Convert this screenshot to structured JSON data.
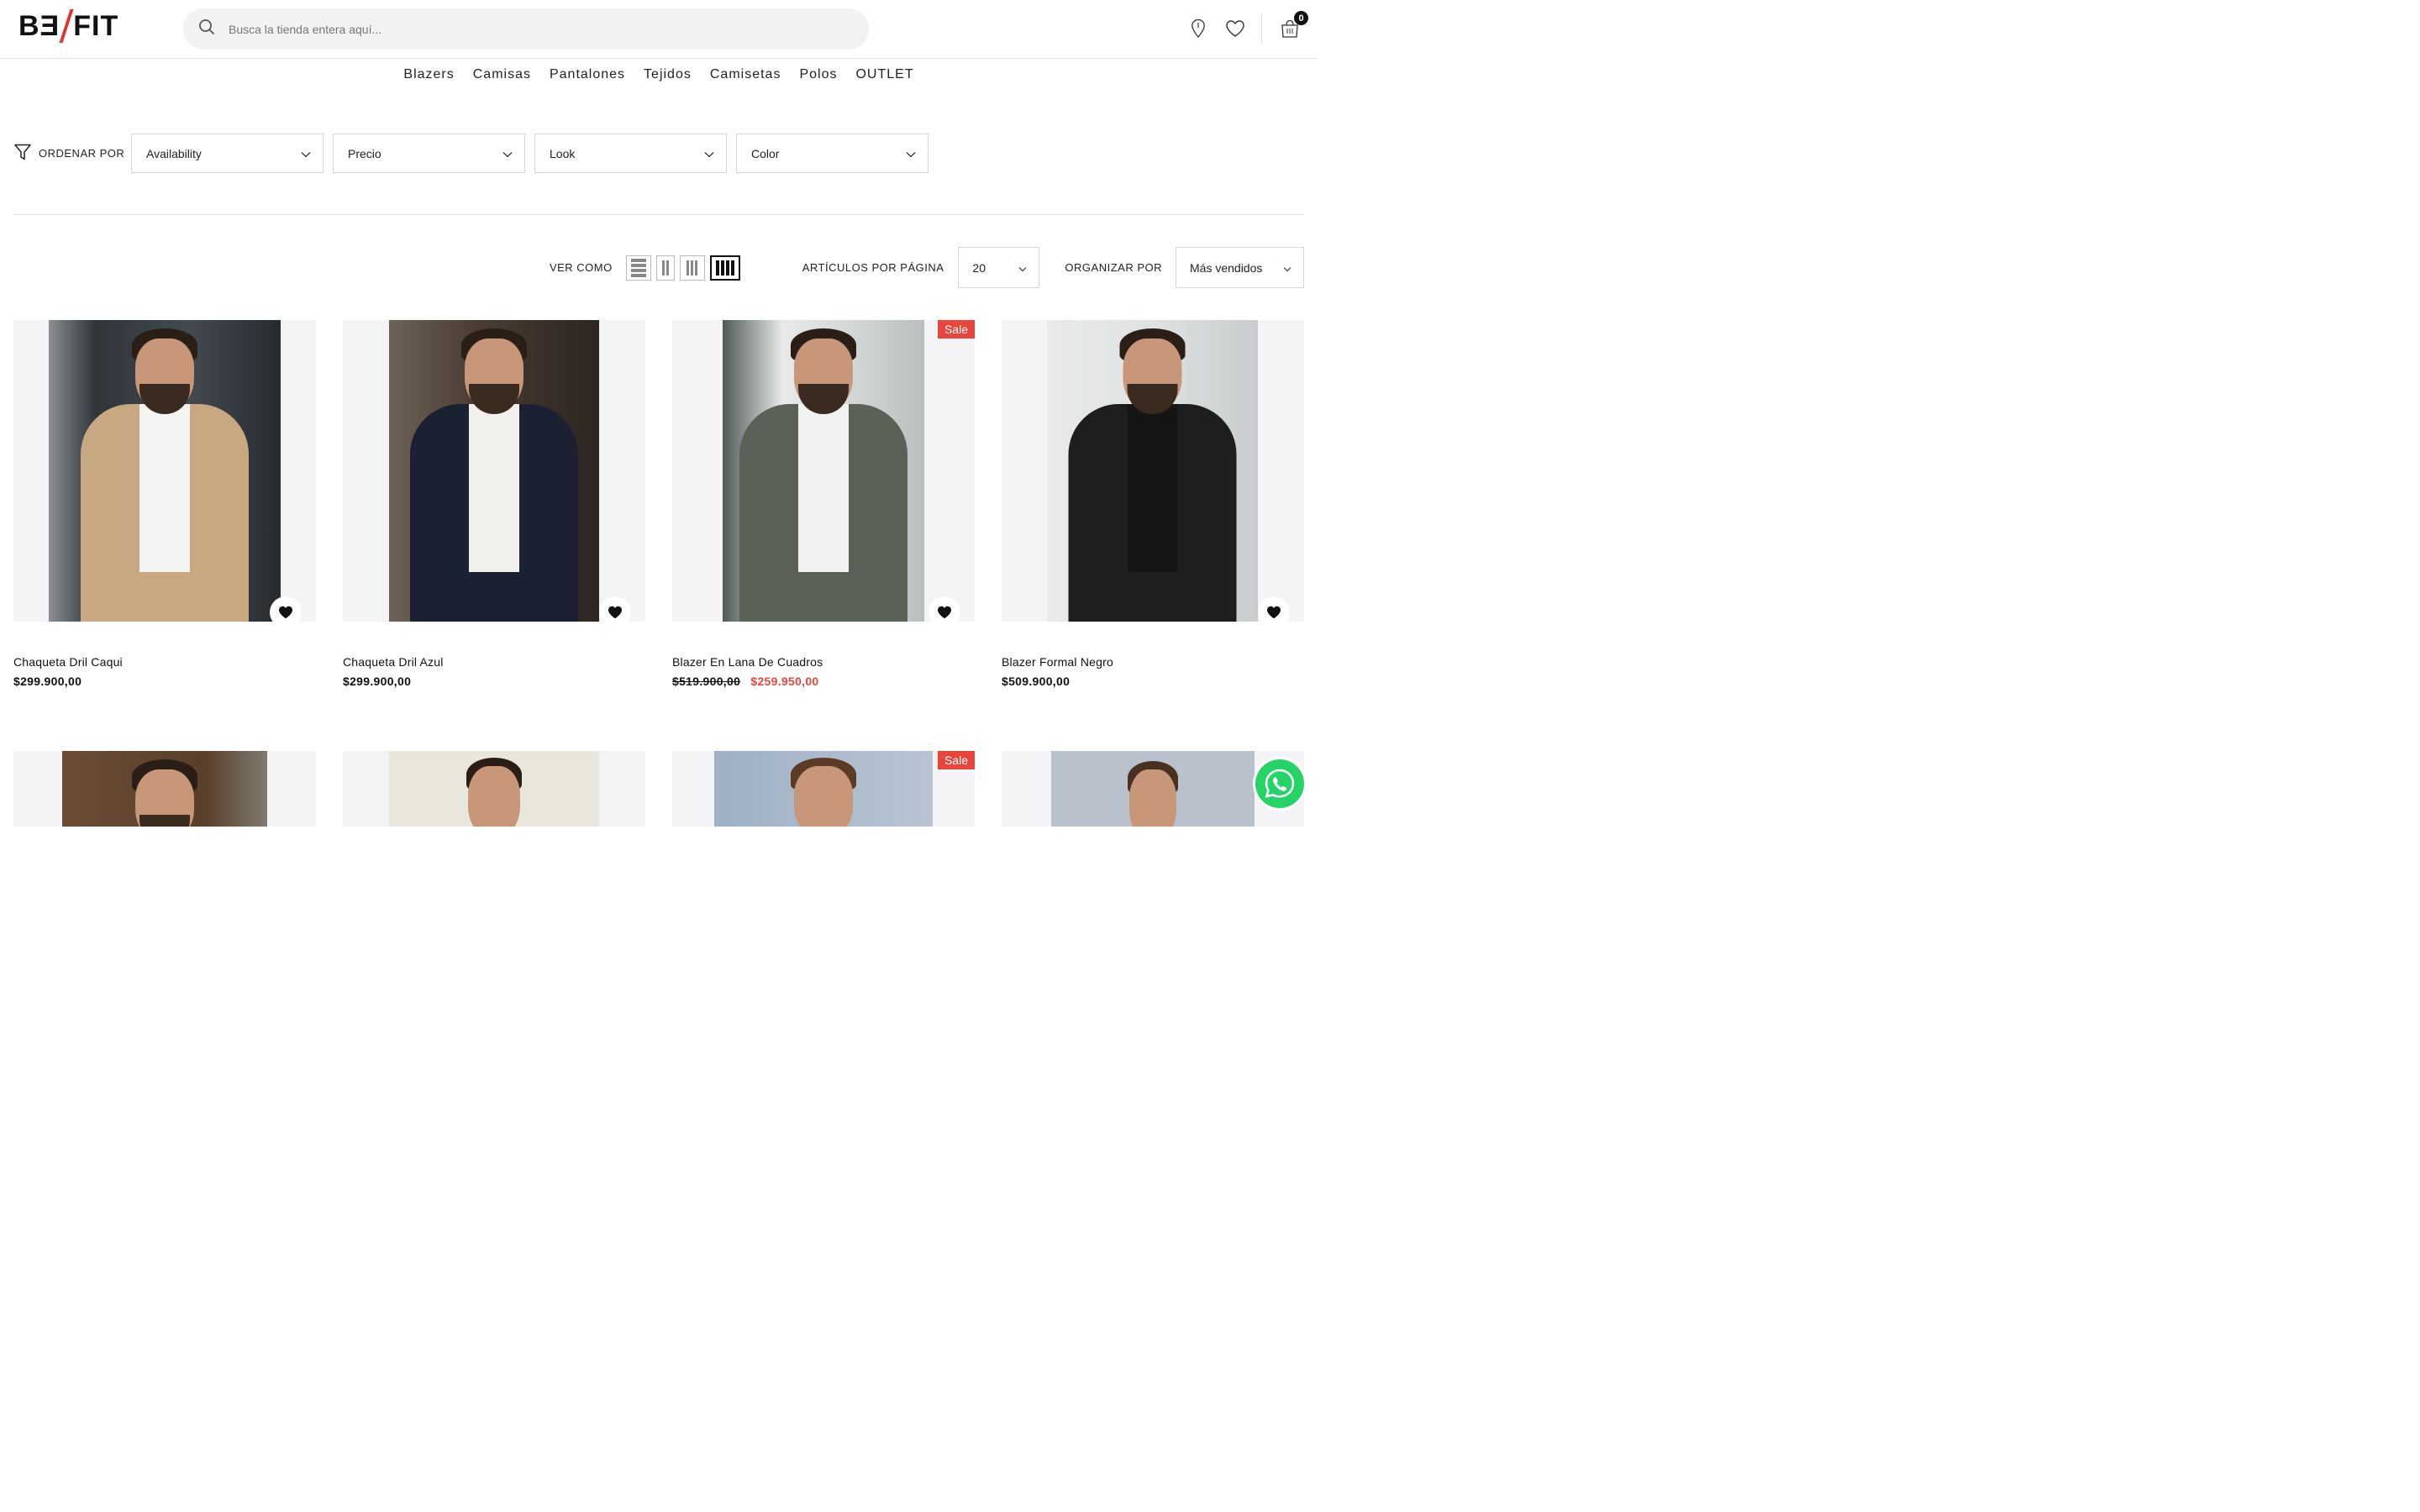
{
  "header": {
    "logo_left": "BƎ",
    "logo_right": "FIT",
    "search_placeholder": "Busca la tienda entera aquí...",
    "cart_count": "0"
  },
  "nav": [
    {
      "label": "Blazers"
    },
    {
      "label": "Camisas"
    },
    {
      "label": "Pantalones"
    },
    {
      "label": "Tejidos"
    },
    {
      "label": "Camisetas"
    },
    {
      "label": "Polos"
    },
    {
      "label": "OUTLET"
    }
  ],
  "filters": {
    "sort_label": "ORDENAR POR",
    "dropdowns": [
      {
        "label": "Availability"
      },
      {
        "label": "Precio"
      },
      {
        "label": "Look"
      },
      {
        "label": "Color"
      }
    ]
  },
  "toolbar": {
    "view_label": "VER COMO",
    "per_page_label": "ARTÍCULOS POR PÁGINA",
    "per_page_value": "20",
    "sort_label": "ORGANIZAR POR",
    "sort_value": "Más vendidos"
  },
  "products": [
    {
      "name": "Chaqueta Dril Caqui",
      "price": "$299.900,00",
      "sale": false,
      "jacket": "#c7a880",
      "shirt": "#f3f3f1",
      "bg": "#3a3f44"
    },
    {
      "name": "Chaqueta Dril Azul",
      "price": "$299.900,00",
      "sale": false,
      "jacket": "#1b2133",
      "shirt": "#f1f0ec",
      "bg": "#5d4f44"
    },
    {
      "name": "Blazer En Lana De Cuadros",
      "old_price": "$519.900,00",
      "price": "$259.950,00",
      "sale": true,
      "sale_label": "Sale",
      "jacket": "#5a6258",
      "shirt": "#f2f2f2",
      "bg": "#d9dcdc"
    },
    {
      "name": "Blazer Formal Negro",
      "price": "$509.900,00",
      "sale": false,
      "jacket": "#1d1f1d",
      "shirt": "#151515",
      "bg": "#e3e5e6"
    }
  ],
  "products_row2": [
    {
      "sale": false,
      "bg": "#6b4d35"
    },
    {
      "sale": false,
      "bg": "#e9e6dc"
    },
    {
      "sale": true,
      "sale_label": "Sale",
      "bg": "#a8b6c8"
    },
    {
      "sale": false,
      "bg": "#b9c1cc"
    }
  ],
  "colors": {
    "accent": "#e4332f",
    "sale": "#e8463c",
    "whatsapp": "#25d366"
  }
}
